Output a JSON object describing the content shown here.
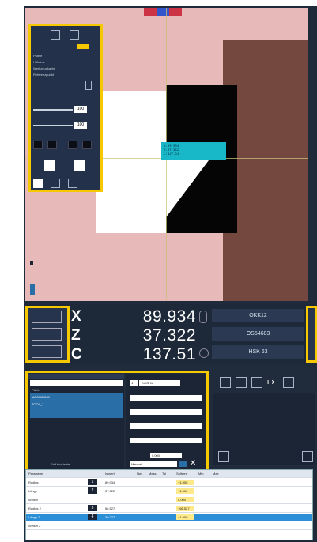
{
  "readouts": [
    {
      "axis": "X",
      "value": "89.934"
    },
    {
      "axis": "Z",
      "value": "37.322"
    },
    {
      "axis": "C",
      "value": "137.51"
    }
  ],
  "tool_info": [
    "OKK12",
    "OS54683",
    "HSK 63"
  ],
  "left_panel": {
    "options": [
      "Profile",
      "Hilfslinie",
      "Werkzeugkante",
      "Referenzpunkt"
    ],
    "value_1": "100",
    "value_2": "100"
  },
  "tree": {
    "items": [
      "FULL",
      "MACHINING",
      "TOOL_1"
    ],
    "footer": "Edit tool table"
  },
  "program_fields": {
    "tool_no": "1",
    "tool_name": "TOOL 12",
    "small_value": "0.000",
    "combo": "Manual"
  },
  "overlay_text": [
    "X:89.934",
    "Z:37.322",
    "C:137.51"
  ],
  "table": {
    "headers": [
      "Parameter",
      "",
      "Istwert",
      "Nw",
      "Mess",
      "Tol",
      "Sollwert",
      "Min",
      "Max"
    ],
    "rows": [
      {
        "name": "Radius",
        "badge": "1",
        "actual": "89.934",
        "nominal": "+1.000"
      },
      {
        "name": "Länge",
        "badge": "2",
        "actual": "37.322",
        "nominal": "+1.000"
      },
      {
        "name": "Winkel",
        "badge": "",
        "actual": "",
        "nominal": "0.000"
      },
      {
        "name": "Radius 2",
        "badge": "3",
        "actual": "66.527",
        "nominal": "+66.527"
      },
      {
        "name": "Länge 2",
        "badge": "4",
        "actual": "30.777",
        "nominal": "+1.000"
      },
      {
        "name": "Winkel 2",
        "badge": "",
        "actual": "",
        "nominal": ""
      }
    ]
  },
  "colors": {
    "highlight": "#f5c800",
    "accent": "#2a6ea8",
    "view_bg": "#e7b9b8"
  }
}
